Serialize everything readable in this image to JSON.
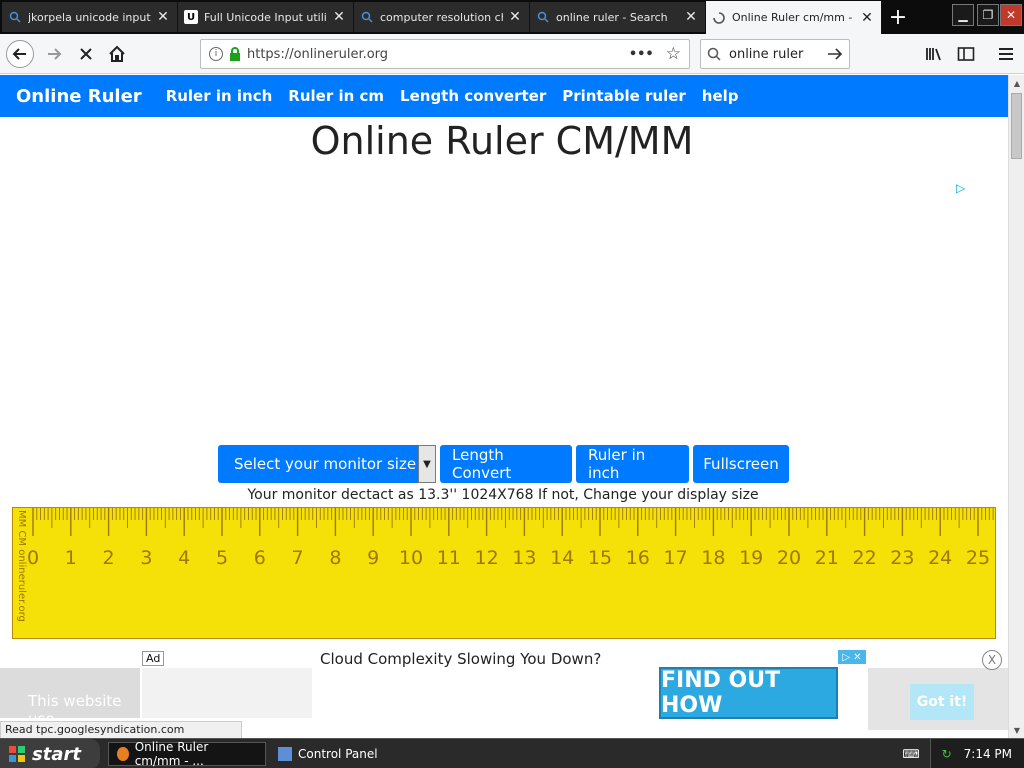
{
  "tabs": [
    {
      "title": "jkorpela unicode input -",
      "icon": "search-icon",
      "active": false
    },
    {
      "title": "Full Unicode Input utility",
      "icon": "site-u-icon",
      "active": false
    },
    {
      "title": "computer resolution che",
      "icon": "search-icon",
      "active": false
    },
    {
      "title": "online ruler - Search",
      "icon": "search-icon",
      "active": false
    },
    {
      "title": "Online Ruler cm/mm - Or",
      "icon": "loading-icon",
      "active": true
    }
  ],
  "toolbar": {
    "url": "https://onlineruler.org",
    "search_value": "online ruler",
    "page_actions": "•••"
  },
  "site_nav": {
    "brand": "Online Ruler",
    "links": [
      "Ruler in inch",
      "Ruler in cm",
      "Length converter",
      "Printable ruler",
      "help"
    ]
  },
  "page": {
    "title": "Online Ruler CM/MM",
    "select_label": "Select your monitor size",
    "buttons": [
      "Length Convert",
      "Ruler in inch",
      "Fullscreen"
    ],
    "monitor_text": "Your monitor dectact as 13.3'' 1024X768 If not, Change your display size"
  },
  "ruler": {
    "side_label": "MM CM  onlineruler.org",
    "numbers": [
      "0",
      "1",
      "2",
      "3",
      "4",
      "5",
      "6",
      "7",
      "8",
      "9",
      "10",
      "11",
      "12",
      "13",
      "14",
      "15",
      "16",
      "17",
      "18",
      "19",
      "20",
      "21",
      "22",
      "23",
      "24",
      "25"
    ],
    "color": "#f5e008",
    "mark_color": "#9a7a00"
  },
  "ad": {
    "label": "Ad",
    "headline": "Cloud Complexity Slowing You Down?",
    "cta": "FIND OUT HOW",
    "close_glyphs": "▷ ✕",
    "cookie_text": "This website use",
    "got_it": "Got it!",
    "dismiss": "X"
  },
  "status_text": "Read tpc.googlesyndication.com",
  "taskbar": {
    "start": "start",
    "items": [
      "Online Ruler cm/mm - ...",
      "Control Panel"
    ],
    "clock": "7:14 PM"
  },
  "colors": {
    "brand_blue": "#007bff",
    "cta_blue": "#2ba9e0"
  }
}
